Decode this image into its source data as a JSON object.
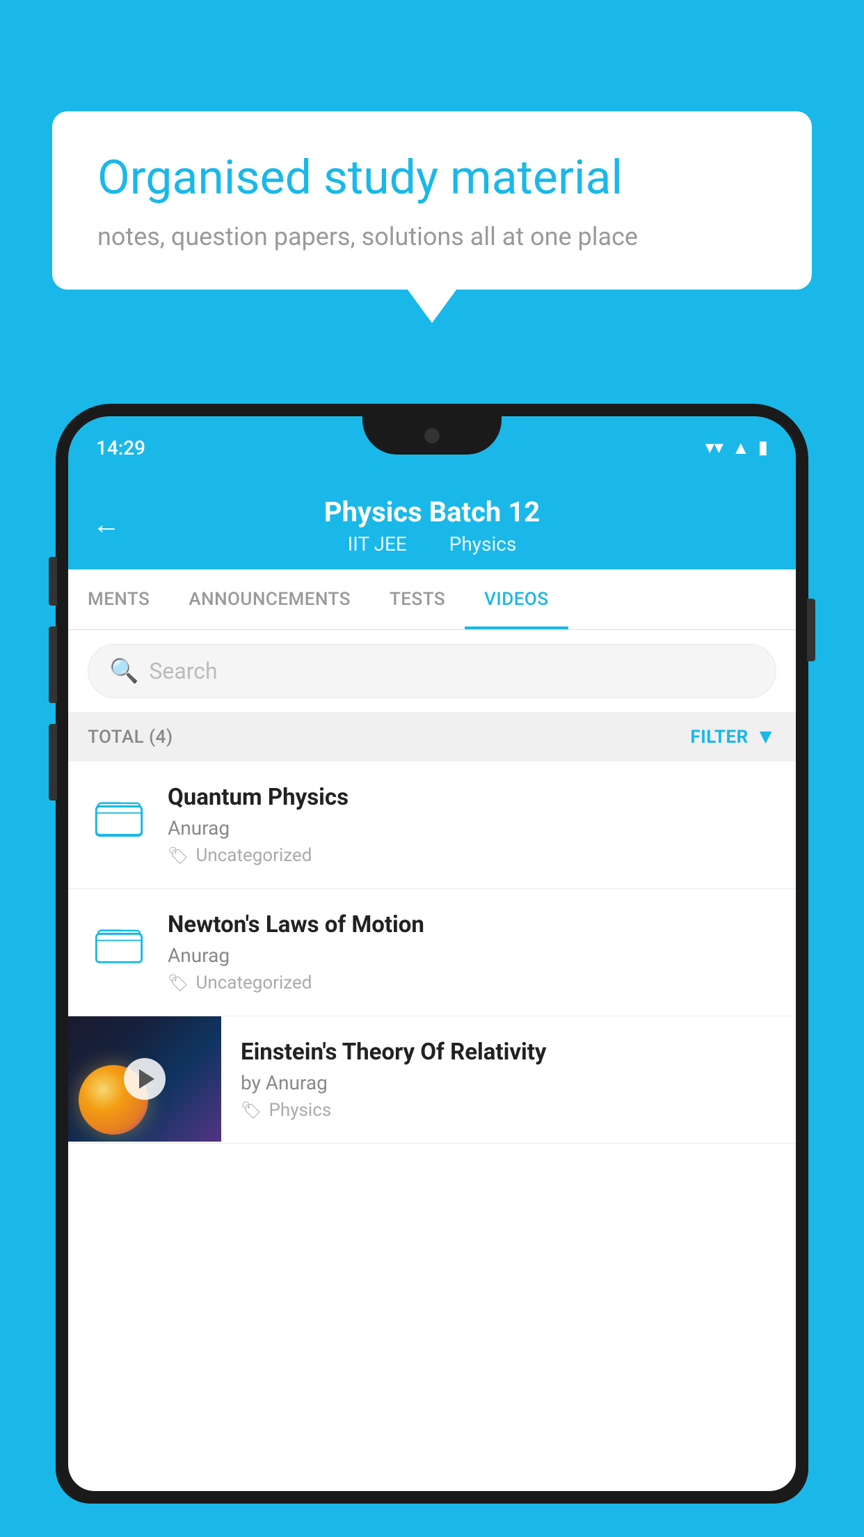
{
  "background_color": "#1ab8e8",
  "bubble": {
    "title": "Organised study material",
    "subtitle": "notes, question papers, solutions all at one place"
  },
  "phone": {
    "status_bar": {
      "time": "14:29"
    },
    "header": {
      "title": "Physics Batch 12",
      "subtitle_part1": "IIT JEE",
      "subtitle_part2": "Physics",
      "back_label": "←"
    },
    "tabs": [
      {
        "label": "MENTS",
        "active": false
      },
      {
        "label": "ANNOUNCEMENTS",
        "active": false
      },
      {
        "label": "TESTS",
        "active": false
      },
      {
        "label": "VIDEOS",
        "active": true
      }
    ],
    "search": {
      "placeholder": "Search"
    },
    "filter_bar": {
      "total_label": "TOTAL (4)",
      "filter_label": "FILTER"
    },
    "video_items": [
      {
        "title": "Quantum Physics",
        "author": "Anurag",
        "tag": "Uncategorized",
        "has_thumbnail": false
      },
      {
        "title": "Newton's Laws of Motion",
        "author": "Anurag",
        "tag": "Uncategorized",
        "has_thumbnail": false
      },
      {
        "title": "Einstein's Theory Of Relativity",
        "author": "by Anurag",
        "tag": "Physics",
        "has_thumbnail": true
      }
    ]
  }
}
